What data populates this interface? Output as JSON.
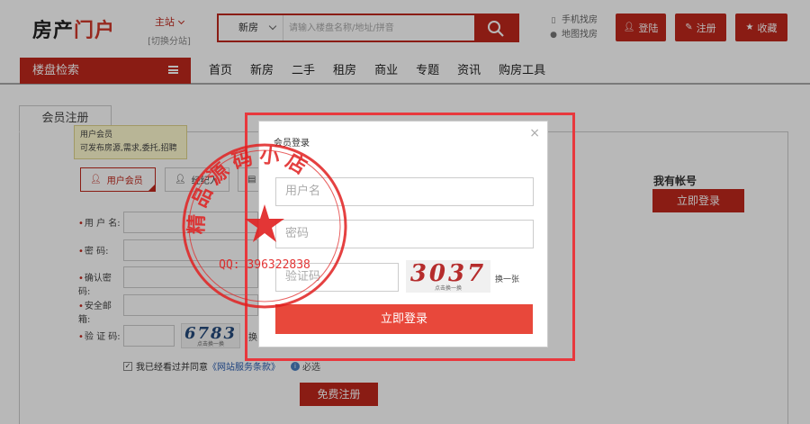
{
  "header": {
    "logo_part1": "房产",
    "logo_part2": "门户",
    "site_main": "主站",
    "site_switch": "[切换分站]",
    "search": {
      "type": "新房",
      "placeholder": "请输入楼盘名称/地址/拼音"
    },
    "mobile_link": "手机找房",
    "map_link": "地图找房",
    "login_label": "登陆",
    "register_label": "注册",
    "favorite_label": "收藏"
  },
  "nav": {
    "search_label": "楼盘检索",
    "items": [
      "首页",
      "新房",
      "二手",
      "租房",
      "商业",
      "专题",
      "资讯",
      "购房工具"
    ]
  },
  "panel": {
    "tab_label": "会员注册",
    "tooltip_title": "用户会员",
    "tooltip_desc": "可发布房源,需求,委托,招聘",
    "member_types": [
      "用户会员",
      "经纪人"
    ],
    "fields": [
      {
        "label": "用 户 名:"
      },
      {
        "label": "密      码:"
      },
      {
        "label": "确认密码:"
      },
      {
        "label": "安全邮箱:"
      },
      {
        "label": "验 证 码:"
      }
    ],
    "captcha_text": "6783",
    "captcha_hint": "点击换一换",
    "change_label": "换",
    "agree_text": "我已经看过并同意",
    "agree_link": "《网站服务条款》",
    "must_label": "必选",
    "submit_label": "免费注册",
    "has_account_label": "我有帐号",
    "side_login_label": "立即登录"
  },
  "modal": {
    "title": "会员登录",
    "close": "×",
    "username_placeholder": "用户名",
    "password_placeholder": "密码",
    "captcha_placeholder": "验证码",
    "captcha_text": "3037",
    "captcha_hint": "点击换一换",
    "change_label": "换一张",
    "submit_label": "立即登录"
  },
  "seal": {
    "arc_text": "精品源码小店",
    "qq_text": "QQ: 396322838"
  },
  "colors": {
    "accent": "#c0281d",
    "modal_button": "#e8483b",
    "frame": "#e8383d",
    "seal": "#e02020"
  }
}
